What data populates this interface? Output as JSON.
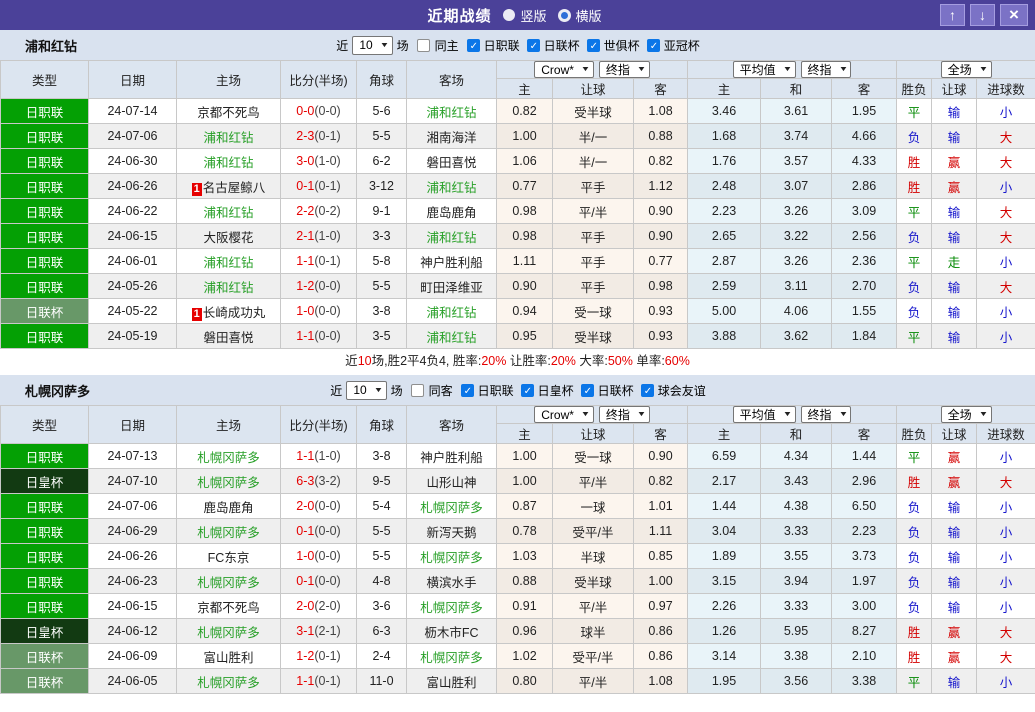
{
  "titlebar": {
    "title": "近期战绩",
    "radios": [
      {
        "label": "竖版",
        "selected": true
      },
      {
        "label": "横版",
        "selected": false
      }
    ],
    "buttons": {
      "up": "↑",
      "down": "↓",
      "close": "×"
    }
  },
  "columns": {
    "type": "类型",
    "date": "日期",
    "home": "主场",
    "score": "比分(半场)",
    "corner": "角球",
    "away": "客场",
    "sub": [
      "主",
      "让球",
      "客",
      "主",
      "和",
      "客",
      "胜负",
      "让球",
      "进球数"
    ]
  },
  "dropdowns": {
    "bookmaker": "Crow*",
    "final": "终指",
    "average": "平均值",
    "fulltime": "全场"
  },
  "colors": {
    "titlebar_bg": "#4b4199",
    "panel_bg": "#d9e2ef",
    "self_team": "#28a028",
    "score_red": "#e60000",
    "win_red": "#d30000",
    "draw_green": "#008800",
    "lose_blue": "#1515cc",
    "leagues": {
      "日职联": "#04a004",
      "日联杯": "#689868",
      "日皇杯": "#123a12"
    }
  },
  "sections": [
    {
      "team": "浦和红钻",
      "filter": {
        "prefix": "近",
        "count": "10",
        "suffix": "场",
        "same": {
          "label": "同主",
          "checked": false
        },
        "leagues": [
          {
            "label": "日职联",
            "checked": true
          },
          {
            "label": "日联杯",
            "checked": true
          },
          {
            "label": "世俱杯",
            "checked": true
          },
          {
            "label": "亚冠杯",
            "checked": true
          }
        ]
      },
      "rows": [
        {
          "type": "日职联",
          "date": "24-07-14",
          "home": "京都不死鸟",
          "home_self": false,
          "score": "0-0",
          "half": "(0-0)",
          "corner": "5-6",
          "away": "浦和红钻",
          "away_self": true,
          "crow": [
            "0.82",
            "受半球",
            "1.08"
          ],
          "avg": [
            "3.46",
            "3.61",
            "1.95"
          ],
          "result": [
            "平",
            "输",
            "小"
          ]
        },
        {
          "type": "日职联",
          "date": "24-07-06",
          "home": "浦和红钻",
          "home_self": true,
          "score": "2-3",
          "half": "(0-1)",
          "corner": "5-5",
          "away": "湘南海洋",
          "away_self": false,
          "crow": [
            "1.00",
            "半/一",
            "0.88"
          ],
          "avg": [
            "1.68",
            "3.74",
            "4.66"
          ],
          "result": [
            "负",
            "输",
            "大"
          ]
        },
        {
          "type": "日职联",
          "date": "24-06-30",
          "home": "浦和红钻",
          "home_self": true,
          "score": "3-0",
          "half": "(1-0)",
          "corner": "6-2",
          "away": "磐田喜悦",
          "away_self": false,
          "crow": [
            "1.06",
            "半/一",
            "0.82"
          ],
          "avg": [
            "1.76",
            "3.57",
            "4.33"
          ],
          "result": [
            "胜",
            "赢",
            "大"
          ]
        },
        {
          "type": "日职联",
          "date": "24-06-26",
          "home": "名古屋鲸八",
          "home_self": false,
          "home_badge": "1",
          "score": "0-1",
          "half": "(0-1)",
          "corner": "3-12",
          "away": "浦和红钻",
          "away_self": true,
          "crow": [
            "0.77",
            "平手",
            "1.12"
          ],
          "avg": [
            "2.48",
            "3.07",
            "2.86"
          ],
          "result": [
            "胜",
            "赢",
            "小"
          ]
        },
        {
          "type": "日职联",
          "date": "24-06-22",
          "home": "浦和红钻",
          "home_self": true,
          "score": "2-2",
          "half": "(0-2)",
          "corner": "9-1",
          "away": "鹿岛鹿角",
          "away_self": false,
          "crow": [
            "0.98",
            "平/半",
            "0.90"
          ],
          "avg": [
            "2.23",
            "3.26",
            "3.09"
          ],
          "result": [
            "平",
            "输",
            "大"
          ]
        },
        {
          "type": "日职联",
          "date": "24-06-15",
          "home": "大阪樱花",
          "home_self": false,
          "score": "2-1",
          "half": "(1-0)",
          "corner": "3-3",
          "away": "浦和红钻",
          "away_self": true,
          "crow": [
            "0.98",
            "平手",
            "0.90"
          ],
          "avg": [
            "2.65",
            "3.22",
            "2.56"
          ],
          "result": [
            "负",
            "输",
            "大"
          ]
        },
        {
          "type": "日职联",
          "date": "24-06-01",
          "home": "浦和红钻",
          "home_self": true,
          "score": "1-1",
          "half": "(0-1)",
          "corner": "5-8",
          "away": "神户胜利船",
          "away_self": false,
          "crow": [
            "1.11",
            "平手",
            "0.77"
          ],
          "avg": [
            "2.87",
            "3.26",
            "2.36"
          ],
          "result": [
            "平",
            "走",
            "小"
          ]
        },
        {
          "type": "日职联",
          "date": "24-05-26",
          "home": "浦和红钻",
          "home_self": true,
          "score": "1-2",
          "half": "(0-0)",
          "corner": "5-5",
          "away": "町田泽维亚",
          "away_self": false,
          "crow": [
            "0.90",
            "平手",
            "0.98"
          ],
          "avg": [
            "2.59",
            "3.11",
            "2.70"
          ],
          "result": [
            "负",
            "输",
            "大"
          ]
        },
        {
          "type": "日联杯",
          "date": "24-05-22",
          "home": "长崎成功丸",
          "home_self": false,
          "home_badge": "1",
          "score": "1-0",
          "half": "(0-0)",
          "corner": "3-8",
          "away": "浦和红钻",
          "away_self": true,
          "crow": [
            "0.94",
            "受一球",
            "0.93"
          ],
          "avg": [
            "5.00",
            "4.06",
            "1.55"
          ],
          "result": [
            "负",
            "输",
            "小"
          ]
        },
        {
          "type": "日职联",
          "date": "24-05-19",
          "home": "磐田喜悦",
          "home_self": false,
          "score": "1-1",
          "half": "(0-0)",
          "corner": "3-5",
          "away": "浦和红钻",
          "away_self": true,
          "crow": [
            "0.95",
            "受半球",
            "0.93"
          ],
          "avg": [
            "3.88",
            "3.62",
            "1.84"
          ],
          "result": [
            "平",
            "输",
            "小"
          ]
        }
      ],
      "summary": [
        {
          "t": "近"
        },
        {
          "t": "10",
          "red": true
        },
        {
          "t": "场,胜2平4负4, 胜率:"
        },
        {
          "t": "20%",
          "red": true
        },
        {
          "t": " 让胜率:"
        },
        {
          "t": "20%",
          "red": true
        },
        {
          "t": " 大率:"
        },
        {
          "t": "50%",
          "red": true
        },
        {
          "t": " 单率:"
        },
        {
          "t": "60%",
          "red": true
        }
      ]
    },
    {
      "team": "札幌冈萨多",
      "filter": {
        "prefix": "近",
        "count": "10",
        "suffix": "场",
        "same": {
          "label": "同客",
          "checked": false
        },
        "leagues": [
          {
            "label": "日职联",
            "checked": true
          },
          {
            "label": "日皇杯",
            "checked": true
          },
          {
            "label": "日联杯",
            "checked": true
          },
          {
            "label": "球会友谊",
            "checked": true
          }
        ]
      },
      "rows": [
        {
          "type": "日职联",
          "date": "24-07-13",
          "home": "札幌冈萨多",
          "home_self": true,
          "score": "1-1",
          "half": "(1-0)",
          "corner": "3-8",
          "away": "神户胜利船",
          "away_self": false,
          "crow": [
            "1.00",
            "受一球",
            "0.90"
          ],
          "avg": [
            "6.59",
            "4.34",
            "1.44"
          ],
          "result": [
            "平",
            "赢",
            "小"
          ]
        },
        {
          "type": "日皇杯",
          "date": "24-07-10",
          "home": "札幌冈萨多",
          "home_self": true,
          "score": "6-3",
          "half": "(3-2)",
          "corner": "9-5",
          "away": "山形山神",
          "away_self": false,
          "crow": [
            "1.00",
            "平/半",
            "0.82"
          ],
          "avg": [
            "2.17",
            "3.43",
            "2.96"
          ],
          "result": [
            "胜",
            "赢",
            "大"
          ]
        },
        {
          "type": "日职联",
          "date": "24-07-06",
          "home": "鹿岛鹿角",
          "home_self": false,
          "score": "2-0",
          "half": "(0-0)",
          "corner": "5-4",
          "away": "札幌冈萨多",
          "away_self": true,
          "crow": [
            "0.87",
            "一球",
            "1.01"
          ],
          "avg": [
            "1.44",
            "4.38",
            "6.50"
          ],
          "result": [
            "负",
            "输",
            "小"
          ]
        },
        {
          "type": "日职联",
          "date": "24-06-29",
          "home": "札幌冈萨多",
          "home_self": true,
          "score": "0-1",
          "half": "(0-0)",
          "corner": "5-5",
          "away": "新泻天鹅",
          "away_self": false,
          "crow": [
            "0.78",
            "受平/半",
            "1.11"
          ],
          "avg": [
            "3.04",
            "3.33",
            "2.23"
          ],
          "result": [
            "负",
            "输",
            "小"
          ]
        },
        {
          "type": "日职联",
          "date": "24-06-26",
          "home": "FC东京",
          "home_self": false,
          "score": "1-0",
          "half": "(0-0)",
          "corner": "5-5",
          "away": "札幌冈萨多",
          "away_self": true,
          "crow": [
            "1.03",
            "半球",
            "0.85"
          ],
          "avg": [
            "1.89",
            "3.55",
            "3.73"
          ],
          "result": [
            "负",
            "输",
            "小"
          ]
        },
        {
          "type": "日职联",
          "date": "24-06-23",
          "home": "札幌冈萨多",
          "home_self": true,
          "score": "0-1",
          "half": "(0-0)",
          "corner": "4-8",
          "away": "横滨水手",
          "away_self": false,
          "crow": [
            "0.88",
            "受半球",
            "1.00"
          ],
          "avg": [
            "3.15",
            "3.94",
            "1.97"
          ],
          "result": [
            "负",
            "输",
            "小"
          ]
        },
        {
          "type": "日职联",
          "date": "24-06-15",
          "home": "京都不死鸟",
          "home_self": false,
          "score": "2-0",
          "half": "(2-0)",
          "corner": "3-6",
          "away": "札幌冈萨多",
          "away_self": true,
          "crow": [
            "0.91",
            "平/半",
            "0.97"
          ],
          "avg": [
            "2.26",
            "3.33",
            "3.00"
          ],
          "result": [
            "负",
            "输",
            "小"
          ]
        },
        {
          "type": "日皇杯",
          "date": "24-06-12",
          "home": "札幌冈萨多",
          "home_self": true,
          "score": "3-1",
          "half": "(2-1)",
          "corner": "6-3",
          "away": "枥木市FC",
          "away_self": false,
          "crow": [
            "0.96",
            "球半",
            "0.86"
          ],
          "avg": [
            "1.26",
            "5.95",
            "8.27"
          ],
          "result": [
            "胜",
            "赢",
            "大"
          ]
        },
        {
          "type": "日联杯",
          "date": "24-06-09",
          "home": "富山胜利",
          "home_self": false,
          "score": "1-2",
          "half": "(0-1)",
          "corner": "2-4",
          "away": "札幌冈萨多",
          "away_self": true,
          "crow": [
            "1.02",
            "受平/半",
            "0.86"
          ],
          "avg": [
            "3.14",
            "3.38",
            "2.10"
          ],
          "result": [
            "胜",
            "赢",
            "大"
          ]
        },
        {
          "type": "日联杯",
          "date": "24-06-05",
          "home": "札幌冈萨多",
          "home_self": true,
          "score": "1-1",
          "half": "(0-1)",
          "corner": "11-0",
          "away": "富山胜利",
          "away_self": false,
          "crow": [
            "0.80",
            "平/半",
            "1.08"
          ],
          "avg": [
            "1.95",
            "3.56",
            "3.38"
          ],
          "result": [
            "平",
            "输",
            "小"
          ]
        }
      ],
      "summary": []
    }
  ]
}
